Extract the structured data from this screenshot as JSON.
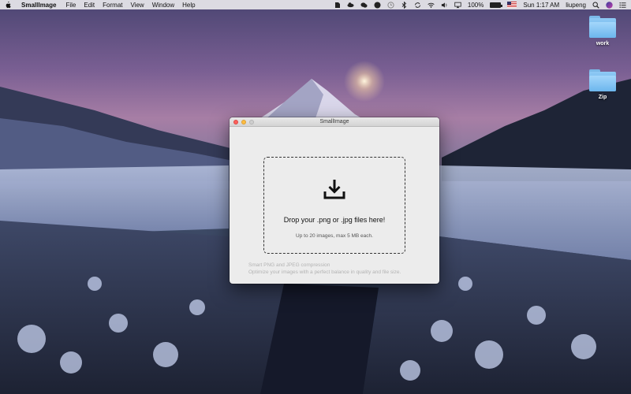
{
  "menubar": {
    "app_name": "SmallImage",
    "menus": [
      "File",
      "Edit",
      "Format",
      "View",
      "Window",
      "Help"
    ],
    "battery_percent": "100%",
    "battery_level": 1.0,
    "clock": "Sun 1:17 AM",
    "user": "liupeng",
    "tray_icons": [
      "evernote-icon",
      "cloud-icon",
      "wechat-icon",
      "message-icon",
      "time-machine-icon",
      "bluetooth-icon",
      "sync-icon",
      "wifi-icon",
      "volume-icon",
      "airplay-icon",
      "battery-icon",
      "us-flag-icon",
      "spotlight-icon",
      "siri-icon",
      "notification-center-icon"
    ]
  },
  "desktop": {
    "icons": [
      {
        "label": "work",
        "icon": "folder-icon"
      },
      {
        "label": "Zip",
        "icon": "folder-icon"
      }
    ]
  },
  "window": {
    "title": "SmallImage",
    "drop_title": "Drop your .png or .jpg files here!",
    "drop_hint": "Up to 20 images, max 5 MB each.",
    "footer_line1": "Smart PNG and JPEG compression",
    "footer_line2": "Optimize your images with a perfect balance in quality and file size."
  },
  "colors": {
    "close": "#fc605c",
    "minimize": "#fdbc40",
    "zoom": "#cfcfcf",
    "window_bg": "#ececec",
    "folder": "#6cb6ed"
  }
}
